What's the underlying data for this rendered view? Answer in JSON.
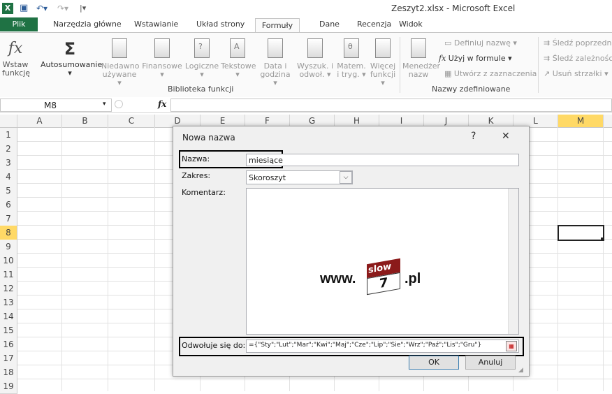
{
  "window": {
    "title": "Zeszyt2.xlsx - Microsoft Excel"
  },
  "tabs": [
    "Plik",
    "Narzędzia główne",
    "Wstawianie",
    "Układ strony",
    "Formuły",
    "Dane",
    "Recenzja",
    "Widok"
  ],
  "ribbon": {
    "buttons": [
      {
        "label1": "Wstaw",
        "label2": "funkcję"
      },
      {
        "label1": "Autosumowanie",
        "label2": "▾"
      },
      {
        "label1": "Niedawno",
        "label2": "używane ▾"
      },
      {
        "label1": "Finansowe",
        "label2": "▾"
      },
      {
        "label1": "Logiczne",
        "label2": "▾"
      },
      {
        "label1": "Tekstowe",
        "label2": "▾"
      },
      {
        "label1": "Data i",
        "label2": "godzina ▾"
      },
      {
        "label1": "Wyszuk. i",
        "label2": "odwoł. ▾"
      },
      {
        "label1": "Matem.",
        "label2": "i tryg. ▾"
      },
      {
        "label1": "Więcej",
        "label2": "funkcji ▾"
      },
      {
        "label1": "Menedżer",
        "label2": "nazw"
      }
    ],
    "group_library": "Biblioteka funkcji",
    "group_names": "Nazwy zdefiniowane",
    "define_name": "Definiuj nazwę ▾",
    "use_in_formula": "Użyj w formule ▾",
    "create_from_selection": "Utwórz z zaznaczenia",
    "trace_precedents": "Śledź poprzedn",
    "trace_dependents": "Śledź zależności",
    "remove_arrows": "Usuń strzałki ▾"
  },
  "formula_bar": {
    "name_box": "M8",
    "fx": "fx",
    "value": ""
  },
  "grid": {
    "columns": [
      "A",
      "B",
      "C",
      "D",
      "E",
      "F",
      "G",
      "H",
      "I",
      "J",
      "K",
      "L",
      "M"
    ],
    "rows": [
      "1",
      "2",
      "3",
      "4",
      "5",
      "6",
      "7",
      "8",
      "9",
      "10",
      "11",
      "12",
      "13",
      "14",
      "15",
      "16",
      "17",
      "18",
      "19"
    ],
    "active_cell": "M8"
  },
  "dialog": {
    "title": "Nowa nazwa",
    "help": "?",
    "close": "✕",
    "name_label": "Nazwa:",
    "name_value": "miesiące",
    "scope_label": "Zakres:",
    "scope_value": "Skoroszyt",
    "comment_label": "Komentarz:",
    "refers_label": "Odwołuje się do:",
    "refers_value": "={\"Sty\";\"Lut\";\"Mar\";\"Kwi\";\"Maj\";\"Cze\";\"Lip\";\"Sie\";\"Wrz\";\"Paź\";\"Lis\";\"Gru\"}",
    "ok": "OK",
    "cancel": "Anuluj"
  },
  "watermark": {
    "www": "www.",
    "slow": "slow",
    "seven": "7",
    "pl": ".pl"
  }
}
